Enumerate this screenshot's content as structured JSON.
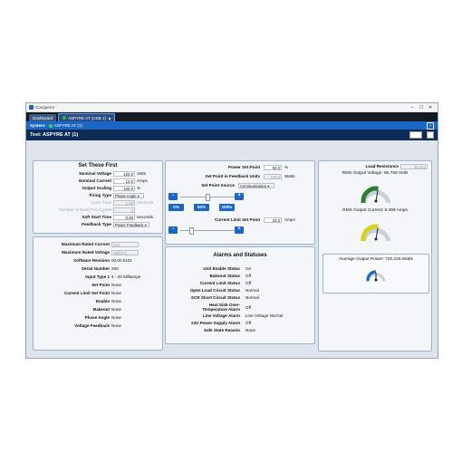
{
  "window": {
    "title": "Conqueror",
    "min": "–",
    "max": "☐",
    "close": "✕"
  },
  "tabs": {
    "dashboard": "Dashboard",
    "active": "ASPYRE AT (USB 1)",
    "active_close": "■"
  },
  "system": {
    "label": "System:",
    "device": "ASPYRE AT (1)",
    "help": "?"
  },
  "test": {
    "title": "Test: ASPYRE AT (1)"
  },
  "setfirst": {
    "title": "Set These First",
    "nominal_voltage": {
      "label": "Nominal Voltage",
      "value": "120.0",
      "unit": "Volts"
    },
    "nominal_current": {
      "label": "Nominal Current",
      "value": "12.0",
      "unit": "Amps"
    },
    "output_scaling": {
      "label": "Output Scaling",
      "value": "100.0",
      "unit": "%"
    },
    "firing_type": {
      "label": "Firing Type",
      "value": "Phase Angle"
    },
    "cycle_time": {
      "label": "Cycle Time",
      "value": "1.50",
      "unit": "Seconds"
    },
    "burst_cycles": {
      "label": "Number of Burst Fire Cycles",
      "value": "4"
    },
    "soft_start": {
      "label": "Soft Start Time",
      "value": "0.00",
      "unit": "Seconds"
    },
    "feedback_type": {
      "label": "Feedback Type",
      "value": "Power Feedback"
    }
  },
  "info": {
    "max_rated_current": {
      "label": "Maximum Rated Current",
      "value": "24A"
    },
    "max_rated_voltage": {
      "label": "Maximum Rated Voltage",
      "value": "480VAC"
    },
    "software_revision": {
      "label": "Software Revision",
      "value": "00.00.0101"
    },
    "serial_number": {
      "label": "Serial Number",
      "value": "260"
    },
    "input_type": {
      "label": "Input Type 1",
      "value": "4 - 20 Milliamps"
    },
    "set_point": {
      "label": "Set Point",
      "value": "None"
    },
    "current_limit_set_point": {
      "label": "Current Limit Set Point",
      "value": "None"
    },
    "enable": {
      "label": "Enable",
      "value": "None"
    },
    "bakeout": {
      "label": "Bakeout",
      "value": "None"
    },
    "phase_angle": {
      "label": "Phase Angle",
      "value": "None"
    },
    "voltage_feedback": {
      "label": "Voltage Feedback",
      "value": "None"
    }
  },
  "setpoint": {
    "power_set_point": {
      "label": "Power Set Point",
      "value": "50.0",
      "unit": "%"
    },
    "set_point_feedback": {
      "label": "Set Point in Feedback Units",
      "value": "720.0",
      "unit": "Watts"
    },
    "set_point_source": {
      "label": "Set Point Source",
      "value": "Communication"
    },
    "minus": "-",
    "plus": "+",
    "slider_fraction": 0.5,
    "presets": [
      "0%",
      "50%",
      "100%"
    ],
    "current_limit": {
      "label": "Current Limit Set Point",
      "value": "24.0",
      "unit": "Amps"
    },
    "current_slider_fraction": 0.2
  },
  "alarms": {
    "title": "Alarms and Statuses",
    "rows": [
      {
        "label": "Unit Enable Status",
        "value": "On"
      },
      {
        "label": "Bakeout Status",
        "value": "Off"
      },
      {
        "label": "Current Limit Status",
        "value": "Off"
      },
      {
        "label": "Open Load Circuit Status",
        "value": "Normal"
      },
      {
        "label": "SCR Short Circuit Status",
        "value": "Normal"
      },
      {
        "label": "Heat Sink Over-Temperature Alarm",
        "value": "Off"
      },
      {
        "label": "Line Voltage Alarm",
        "value": "Line Voltage Normal"
      },
      {
        "label": "24V Power Supply Alarm",
        "value": "Off"
      },
      {
        "label": "Safe State Reason",
        "value": "None"
      }
    ]
  },
  "load": {
    "title": "Load Resistance",
    "resistance": "10.212",
    "rms_voltage": "RMS Output Voltage: 85.759 Volts",
    "rms_current": "RMS Output Current: 8.398 Amps",
    "avg_power": "Average Output Power: 720.226 Watts",
    "gauge_voltage": {
      "fraction": 0.55,
      "color": "#2e7d32"
    },
    "gauge_current": {
      "fraction": 0.55,
      "color": "#d6d21a"
    },
    "gauge_power": {
      "fraction": 0.5,
      "color": "#1d67c4"
    }
  }
}
